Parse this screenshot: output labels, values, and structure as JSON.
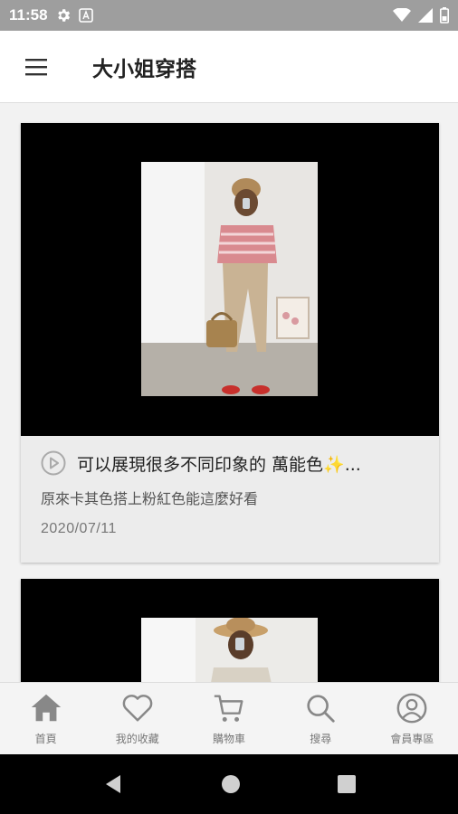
{
  "status_bar": {
    "time": "11:58"
  },
  "app_bar": {
    "title": "大小姐穿搭"
  },
  "posts": [
    {
      "title": "可以展現很多不同印象的 萬能色✨...",
      "subtitle": "原來卡其色搭上粉紅色能這麼好看",
      "date": "2020/07/11"
    },
    {
      "title": "",
      "subtitle": "",
      "date": ""
    }
  ],
  "bottom_nav": {
    "items": [
      {
        "label": "首頁",
        "icon": "home-icon"
      },
      {
        "label": "我的收藏",
        "icon": "heart-icon"
      },
      {
        "label": "購物車",
        "icon": "cart-icon"
      },
      {
        "label": "搜尋",
        "icon": "search-icon"
      },
      {
        "label": "會員專區",
        "icon": "user-icon"
      }
    ]
  },
  "colors": {
    "status_bar": "#9e9e9e",
    "card_bg": "#ececec",
    "nav_icon": "#888888"
  }
}
